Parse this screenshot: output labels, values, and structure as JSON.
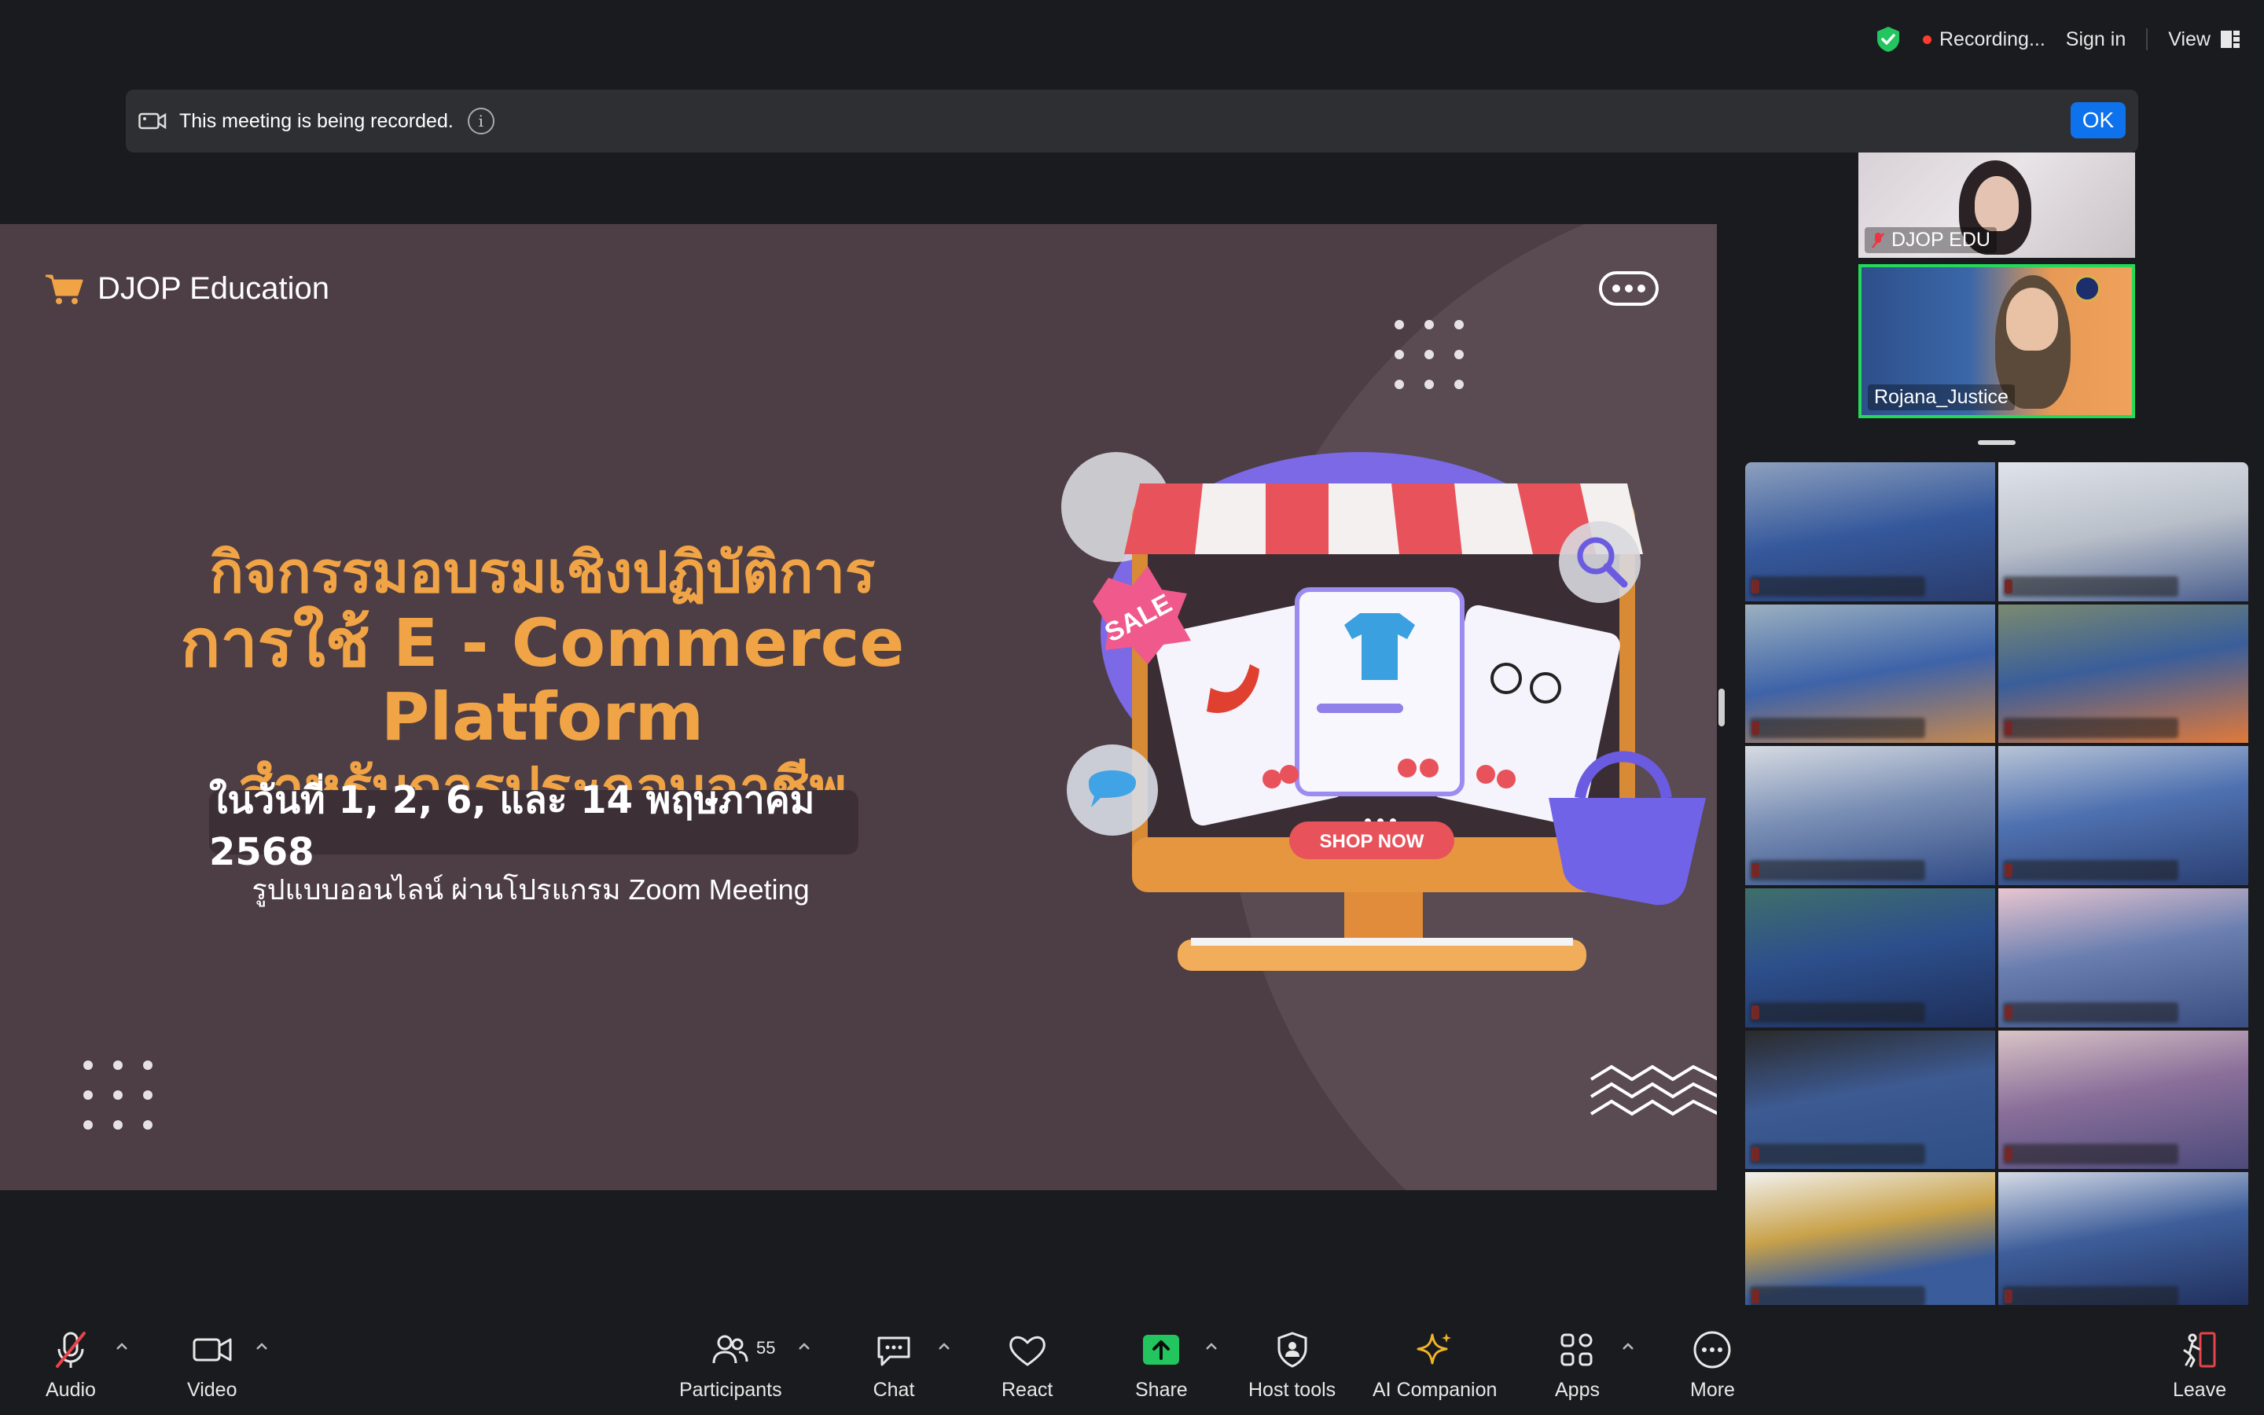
{
  "top_bar": {
    "recording_label": "Recording...",
    "sign_in_label": "Sign in",
    "view_label": "View"
  },
  "notice": {
    "text": "This meeting is being recorded.",
    "info_glyph": "i",
    "ok_label": "OK"
  },
  "slide": {
    "brand": "DJOP Education",
    "title_line1": "กิจกรรมอบรมเชิงปฏิบัติการ",
    "title_line2": "การใช้ E - Commerce Platform",
    "title_line3": "สำหรับการประกอบอาชีพ",
    "date": "ในวันที่ 1, 2, 6, และ 14 พฤษภาคม 2568",
    "subtitle": "รูปแบบออนไลน์ ผ่านโปรแกรม Zoom Meeting",
    "sale_label": "SALE",
    "shop_now_label": "SHOP NOW",
    "colors": {
      "background": "#4d3d44",
      "accent": "#f0a446"
    }
  },
  "thumbnails": [
    {
      "name": "DJOP EDU"
    },
    {
      "name": "Rojana_Justice",
      "active_speaker": true
    }
  ],
  "toolbar": {
    "audio": "Audio",
    "video": "Video",
    "participants": "Participants",
    "participants_count": "55",
    "chat": "Chat",
    "react": "React",
    "share": "Share",
    "host_tools": "Host tools",
    "ai_companion": "AI Companion",
    "apps": "Apps",
    "more": "More",
    "leave": "Leave"
  },
  "icons": [
    "shield-check-icon",
    "camera-icon",
    "info-icon",
    "cart-icon",
    "microphone-muted-icon",
    "video-camera-icon",
    "participants-icon",
    "chat-icon",
    "heart-icon",
    "share-arrow-icon",
    "host-shield-icon",
    "sparkle-icon",
    "apps-icon",
    "more-dots-icon",
    "leave-door-icon",
    "chevron-up-icon"
  ]
}
